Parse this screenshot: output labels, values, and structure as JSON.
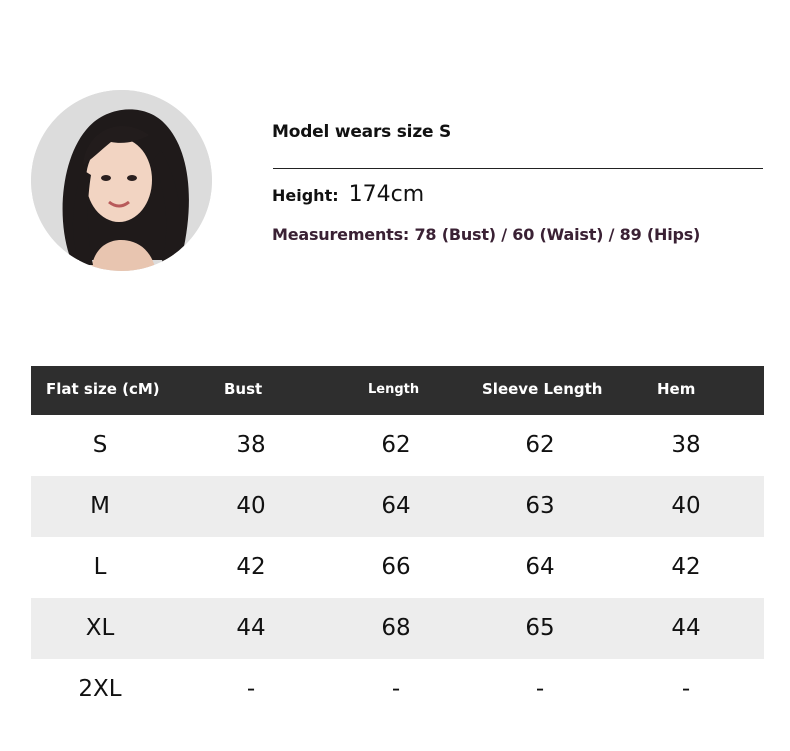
{
  "model": {
    "title": "Model wears size S",
    "height_label": "Height:",
    "height_value": "174cm",
    "measurements": "Measurements: 78 (Bust) / 60 (Waist) / 89 (Hips)"
  },
  "table": {
    "headers": [
      "Flat size (cM)",
      "Bust",
      "Length",
      "Sleeve Length",
      "Hem"
    ],
    "rows": [
      [
        "S",
        "38",
        "62",
        "62",
        "38"
      ],
      [
        "M",
        "40",
        "64",
        "63",
        "40"
      ],
      [
        "L",
        "42",
        "66",
        "64",
        "42"
      ],
      [
        "XL",
        "44",
        "68",
        "65",
        "44"
      ],
      [
        "2XL",
        "-",
        "-",
        "-",
        "-"
      ]
    ]
  },
  "colors": {
    "header_bg": "#2e2e2e",
    "row_shade": "#ededed",
    "measurements_text": "#3a2134"
  }
}
